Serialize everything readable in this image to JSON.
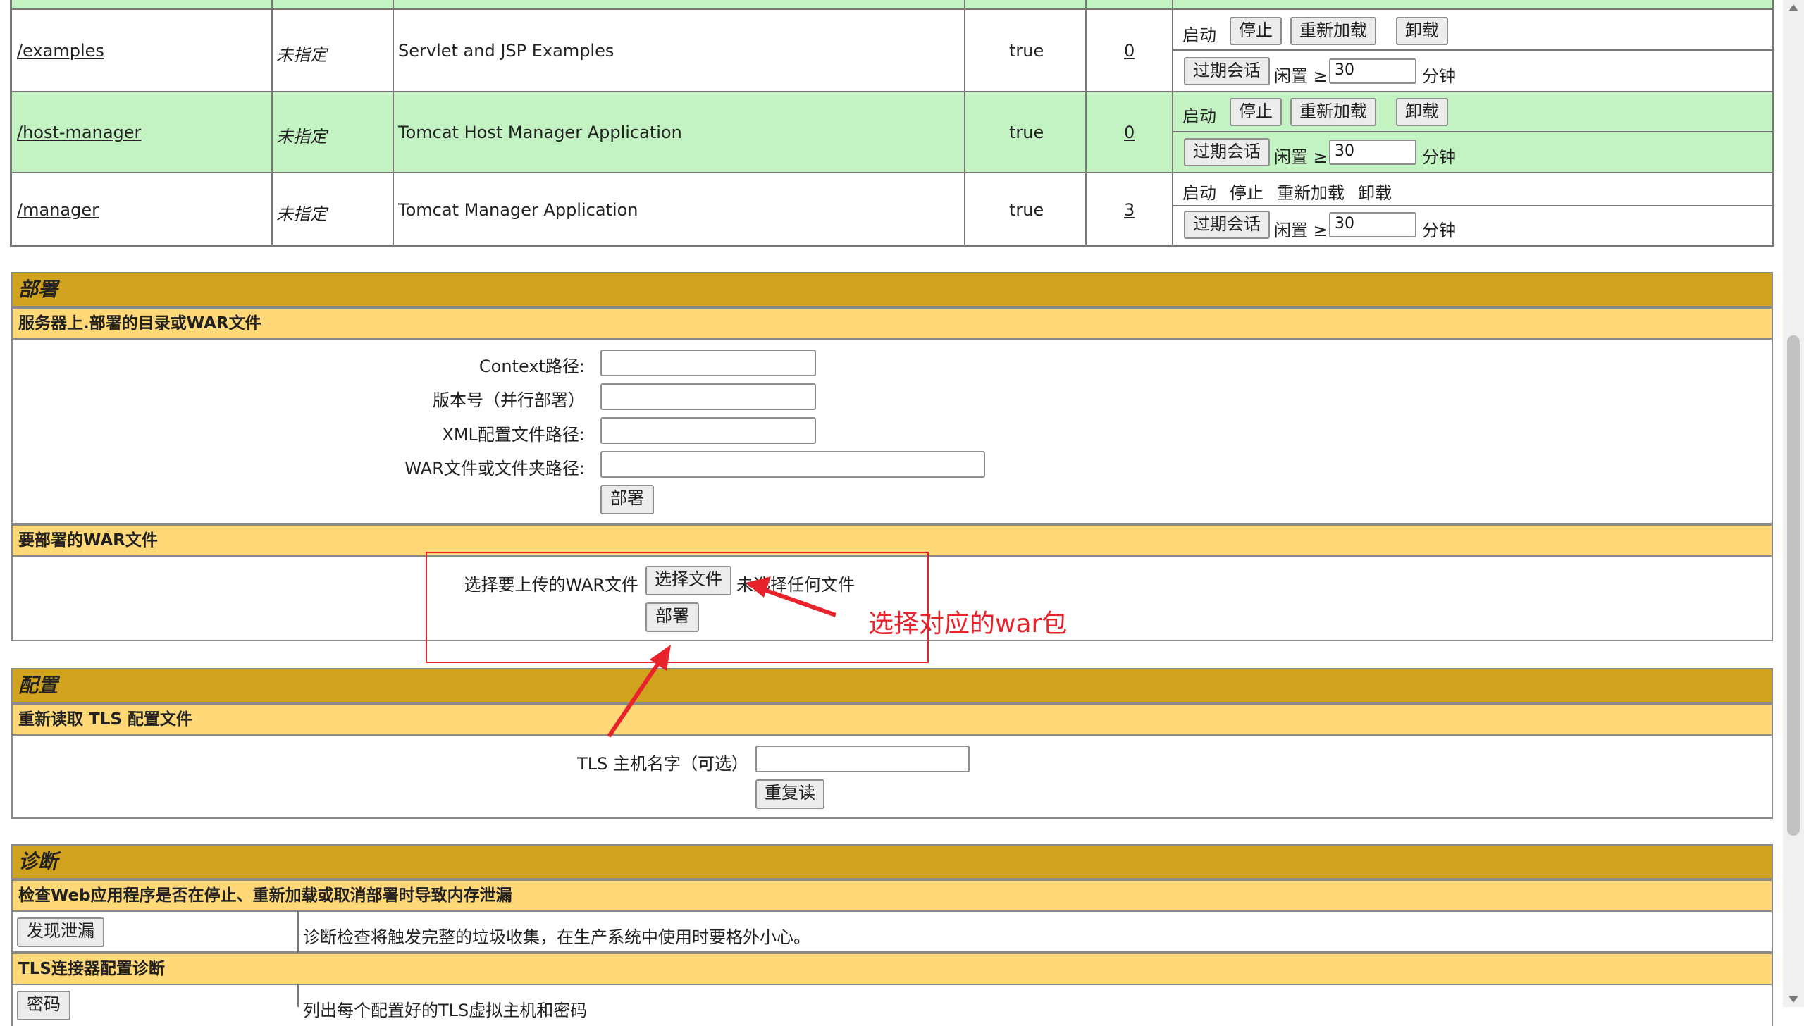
{
  "apps": {
    "rows": [
      {
        "path": "/examples",
        "version": "未指定",
        "display": "Servlet and JSP Examples",
        "running": "true",
        "sessions": "0",
        "highlight": false,
        "cmds": {
          "start": "启动",
          "stop": "停止",
          "reload": "重新加载",
          "undeploy": "卸载"
        },
        "expire": {
          "button": "过期会话",
          "idle": "闲置 ≥",
          "value": "30",
          "unit": "分钟"
        }
      },
      {
        "path": "/host-manager",
        "version": "未指定",
        "display": "Tomcat Host Manager Application",
        "running": "true",
        "sessions": "0",
        "highlight": true,
        "cmds": {
          "start": "启动",
          "stop": "停止",
          "reload": "重新加载",
          "undeploy": "卸载"
        },
        "expire": {
          "button": "过期会话",
          "idle": "闲置 ≥",
          "value": "30",
          "unit": "分钟"
        }
      },
      {
        "path": "/manager",
        "version": "未指定",
        "display": "Tomcat Manager Application",
        "running": "true",
        "sessions": "3",
        "highlight": false,
        "cmds": {
          "start": "启动",
          "stop": "停止",
          "reload": "重新加载",
          "undeploy": "卸载"
        },
        "expire": {
          "button": "过期会话",
          "idle": "闲置 ≥",
          "value": "30",
          "unit": "分钟"
        }
      }
    ]
  },
  "deploy": {
    "title": "部署",
    "server_dir": {
      "subtitle": "服务器上.部署的目录或WAR文件",
      "context_label": "Context路径:",
      "version_label": "版本号（并行部署）",
      "xml_label": "XML配置文件路径:",
      "war_label": "WAR文件或文件夹路径:",
      "context_value": "",
      "version_value": "",
      "xml_value": "",
      "war_value": "",
      "deploy_button": "部署"
    },
    "upload": {
      "subtitle": "要部署的WAR文件",
      "choose_label": "选择要上传的WAR文件",
      "choose_button": "选择文件",
      "no_file": "未选择任何文件",
      "deploy_button": "部署"
    },
    "annotation": "选择对应的war包"
  },
  "config": {
    "title": "配置",
    "subtitle": "重新读取 TLS 配置文件",
    "tls_label": "TLS 主机名字（可选）",
    "tls_value": "",
    "reload_button": "重复读"
  },
  "diagnostics": {
    "title": "诊断",
    "leak_subtitle": "检查Web应用程序是否在停止、重新加载或取消部署时导致内存泄漏",
    "leak_button": "发现泄漏",
    "leak_desc": "诊断检查将触发完整的垃圾收集，在生产系统中使用时要格外小心。",
    "tls_subtitle": "TLS连接器配置诊断",
    "tls_button": "密码",
    "tls_desc": "列出每个配置好的TLS虚拟主机和密码"
  },
  "colors": {
    "row_highlight": "#c3f2c3",
    "section": "#d1a21d",
    "subsection": "#ffd877",
    "annotation": "#e8232b"
  }
}
